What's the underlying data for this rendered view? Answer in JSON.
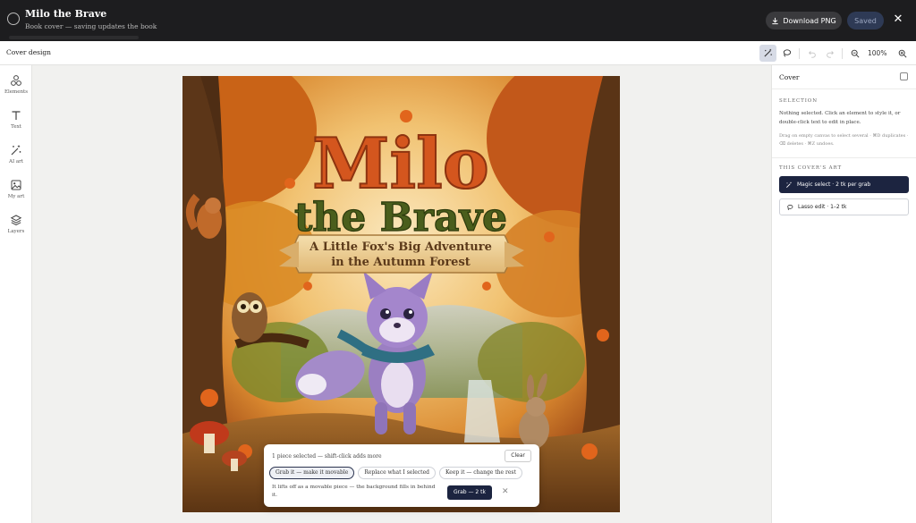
{
  "topbar": {
    "title": "Milo the Brave",
    "subtitle": "Book cover — saving updates the book",
    "download_label": "Download PNG",
    "saved_label": "Saved",
    "close_glyph": "✕"
  },
  "subbar": {
    "title": "Cover design",
    "zoom": "100%"
  },
  "rail": {
    "items": [
      {
        "label": "Elements",
        "icon": "shapes-icon"
      },
      {
        "label": "Text",
        "icon": "text-icon"
      },
      {
        "label": "AI art",
        "icon": "magic-wand-icon"
      },
      {
        "label": "My art",
        "icon": "image-icon"
      },
      {
        "label": "Layers",
        "icon": "layers-icon"
      }
    ]
  },
  "cover": {
    "title_line1": "Milo",
    "title_line2": "the Brave",
    "banner_line1": "A Little Fox's Big Adventure",
    "banner_line2": "in the Autumn Forest"
  },
  "panel": {
    "title": "Cover",
    "selection_label": "SELECTION",
    "selection_text": "Nothing selected. Click an element to style it, or double-click text to edit in place.",
    "selection_hint": "Drag on empty canvas to select several · ⌘D duplicates · ⌫ deletes · ⌘Z undoes.",
    "art_label": "THIS COVER'S ART",
    "magic_btn": "Magic select · 2 tk per grab",
    "lasso_btn": "Lasso edit · 1–2 tk"
  },
  "popover": {
    "status": "1 piece selected — shift-click adds more",
    "clear": "Clear",
    "chips": [
      "Grab it — make it movable",
      "Replace what I selected",
      "Keep it — change the rest"
    ],
    "description": "It lifts off as a movable piece — the background fills in behind it.",
    "grab_btn": "Grab — 2 tk",
    "dismiss": "✕"
  },
  "colors": {
    "topbar_bg": "#1d1d1f",
    "accent_navy": "#1c2440",
    "title_orange": "#d4561e",
    "title_green": "#4a5e1c"
  }
}
